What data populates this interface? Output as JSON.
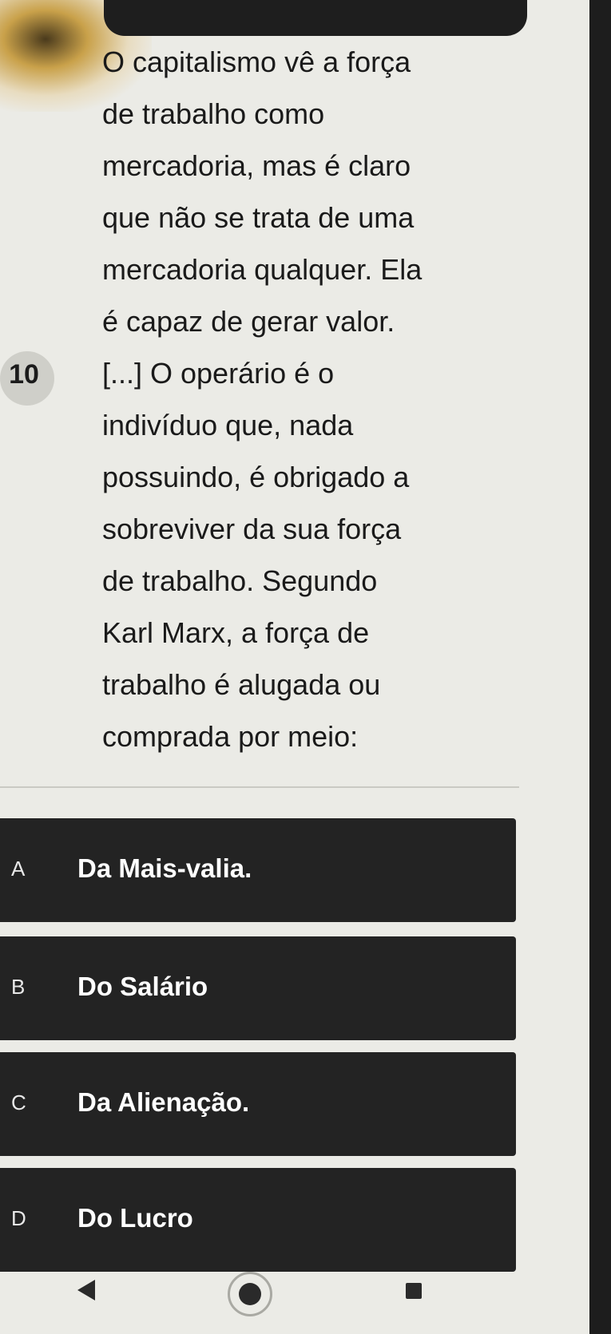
{
  "question": {
    "number": "10",
    "lines": [
      "O capitalismo vê a força",
      "de trabalho como",
      "mercadoria, mas é claro",
      "que não se trata de uma",
      "mercadoria qualquer. Ela",
      "é capaz de gerar valor.",
      "[...] O operário é o",
      "indivíduo que, nada",
      "possuindo, é obrigado a",
      "sobreviver da sua força",
      "de trabalho. Segundo",
      "Karl Marx, a força de",
      "trabalho é alugada ou",
      "comprada por meio:"
    ]
  },
  "options": [
    {
      "letter": "A",
      "text": "Da Mais-valia."
    },
    {
      "letter": "B",
      "text": "Do Salário"
    },
    {
      "letter": "C",
      "text": "Da Alienação."
    },
    {
      "letter": "D",
      "text": "Do Lucro"
    }
  ],
  "navbar": {
    "back_icon": "back-triangle-icon",
    "home_icon": "home-circle-icon",
    "recent_icon": "recent-apps-square-icon"
  },
  "colors": {
    "option_bg": "#232323",
    "option_text": "#ffffff",
    "page_bg": "#ebebe6"
  }
}
